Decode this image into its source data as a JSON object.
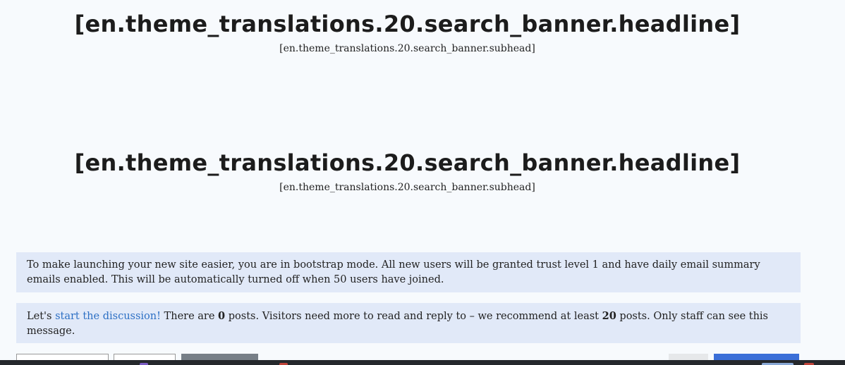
{
  "banners": [
    {
      "headline": "[en.theme_translations.20.search_banner.headline]",
      "subhead": "[en.theme_translations.20.search_banner.subhead]"
    },
    {
      "headline": "[en.theme_translations.20.search_banner.headline]",
      "subhead": "[en.theme_translations.20.search_banner.subhead]"
    }
  ],
  "bootstrap_notice": {
    "text": "To make launching your new site easier, you are in bootstrap mode. All new users will be granted trust level 1 and have daily email summary emails enabled. This will be automatically turned off when 50 users have joined."
  },
  "discussion_notice": {
    "prefix": "Let's ",
    "link": "start the discussion!",
    "part1": " There are ",
    "posts_count": "0",
    "part2": " posts. Visitors need more to read and reply to – we recommend at least ",
    "recommended": "20",
    "part3": " posts. Only staff can see this message."
  },
  "colors": {
    "background": "#f7fafd",
    "notice_bg": "#e1e9f8",
    "link": "#2c6fc4",
    "primary_button": "#3a6fd8"
  }
}
